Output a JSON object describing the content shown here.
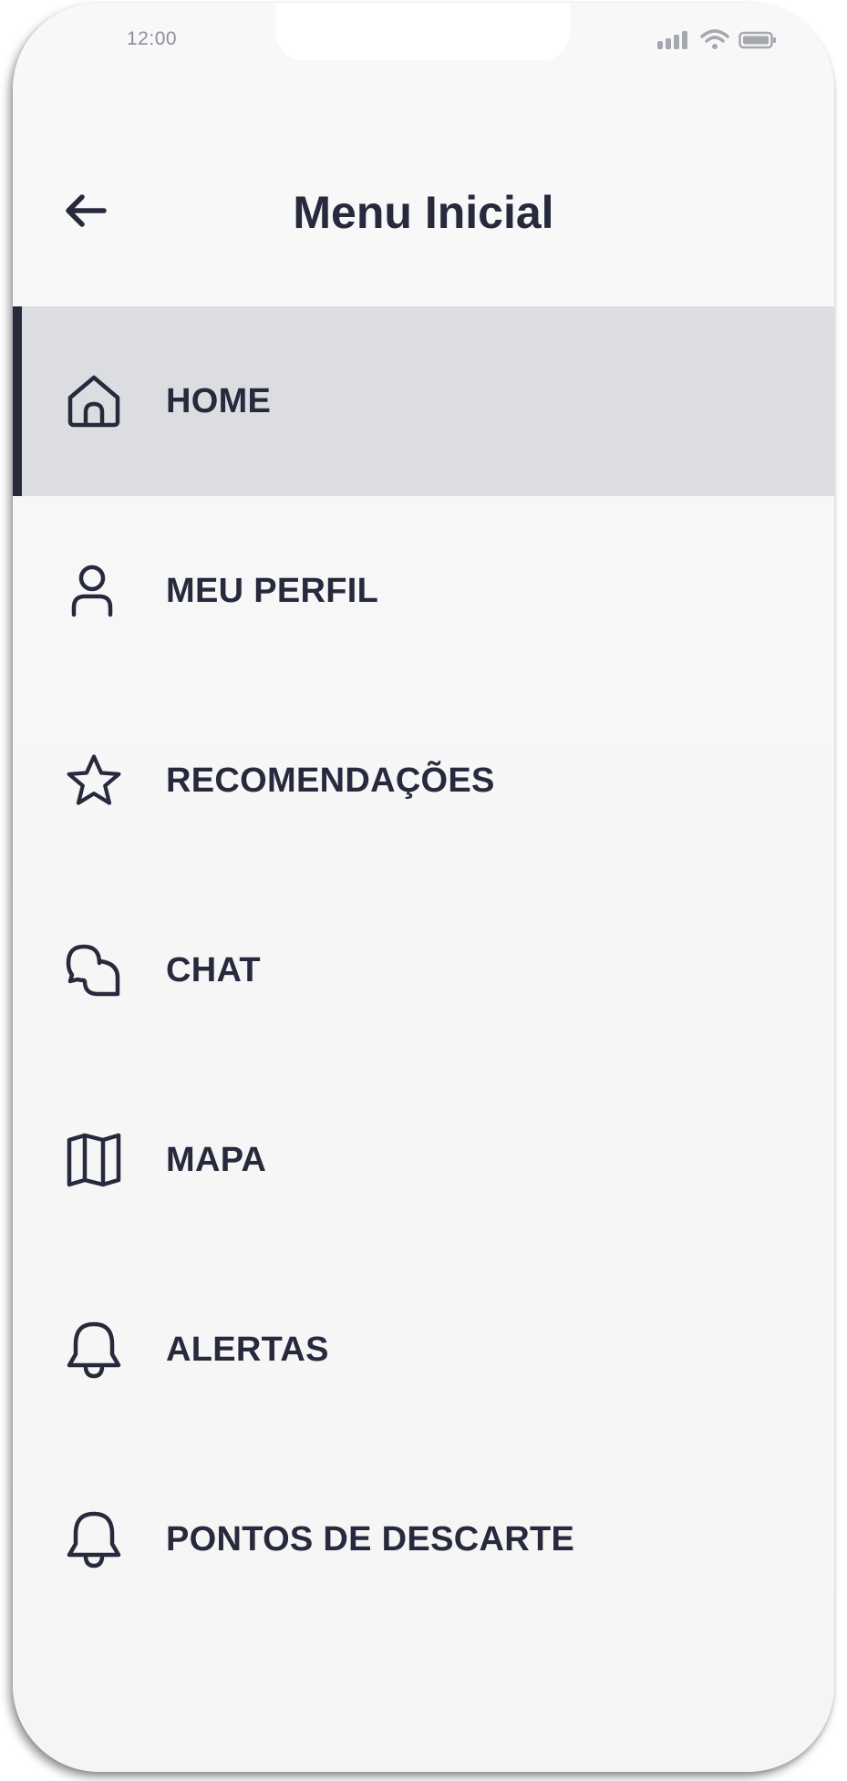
{
  "status_bar": {
    "time": "12:00"
  },
  "header": {
    "title": "Menu Inicial",
    "back_icon": "arrow-left-icon"
  },
  "colors": {
    "text": "#272a3d",
    "active_bg": "#dcdde0",
    "background": "#f7f7f7"
  },
  "menu": {
    "items": [
      {
        "label": "HOME",
        "icon": "home-icon",
        "active": true
      },
      {
        "label": "MEU PERFIL",
        "icon": "user-icon",
        "active": false
      },
      {
        "label": "RECOMENDAÇÕES",
        "icon": "star-icon",
        "active": false
      },
      {
        "label": "CHAT",
        "icon": "chat-icon",
        "active": false
      },
      {
        "label": "MAPA",
        "icon": "map-icon",
        "active": false
      },
      {
        "label": "ALERTAS",
        "icon": "bell-icon",
        "active": false
      },
      {
        "label": "PONTOS DE DESCARTE",
        "icon": "bell-icon",
        "active": false
      }
    ]
  }
}
